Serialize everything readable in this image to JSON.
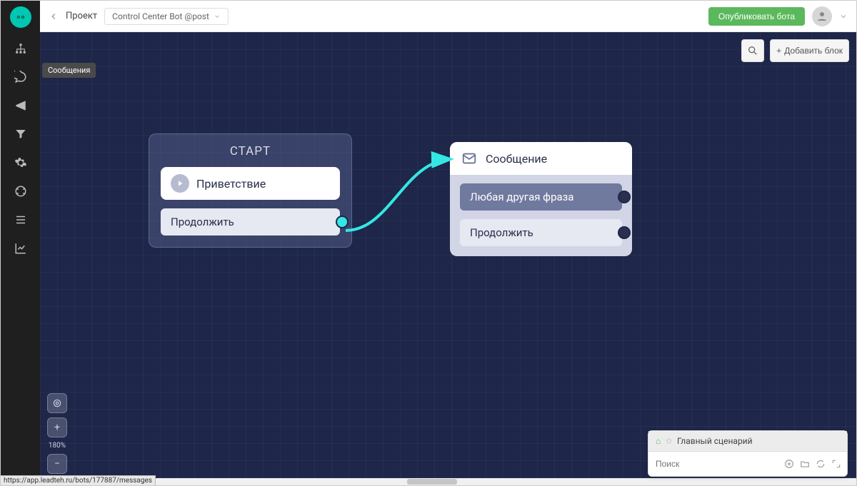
{
  "header": {
    "back_icon": "←",
    "project_label": "Проект",
    "project_name": "Control Center Bot @post",
    "publish_label": "Опубликовать бота"
  },
  "sidebar": {
    "tooltip": "Сообщения"
  },
  "canvas_controls": {
    "search_icon": "⌕",
    "add_label": "Добавить блок"
  },
  "node_start": {
    "title": "СТАРТ",
    "inner_title": "Приветствие",
    "row1": "Продолжить"
  },
  "node_msg": {
    "title": "Сообщение",
    "row1": "Любая другая фраза",
    "row2": "Продолжить"
  },
  "zoom": {
    "level": "180%"
  },
  "scenario": {
    "title": "Главный сценарий",
    "search_placeholder": "Поиск"
  },
  "status_url": "https://app.leadteh.ru/bots/177887/messages"
}
